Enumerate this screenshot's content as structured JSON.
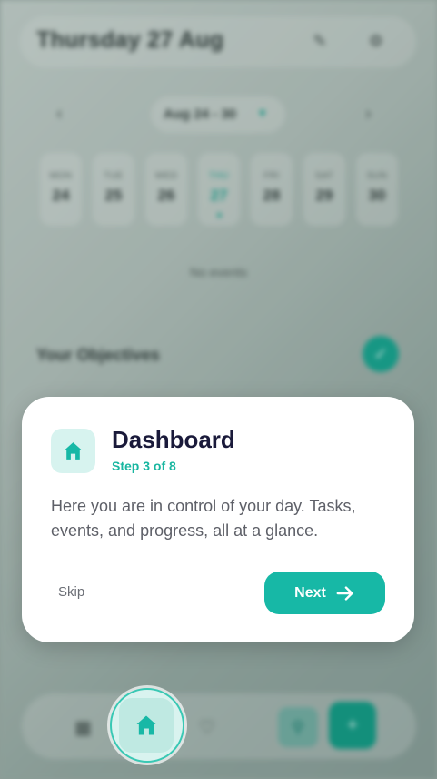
{
  "background": {
    "date_title": "Thursday 27 Aug",
    "week_range": "Aug 24 - 30",
    "week_days": [
      {
        "name": "MON",
        "date": "24"
      },
      {
        "name": "TUE",
        "date": "25"
      },
      {
        "name": "WED",
        "date": "26"
      },
      {
        "name": "THU",
        "date": "27"
      },
      {
        "name": "FRI",
        "date": "28"
      },
      {
        "name": "SAT",
        "date": "29"
      },
      {
        "name": "SUN",
        "date": "30"
      }
    ],
    "no_events": "No events",
    "objectives_title": "Your Objectives"
  },
  "dialog": {
    "icon": "home-icon",
    "title": "Dashboard",
    "step": "Step 3 of 8",
    "body": "Here you are in control of your day. Tasks, events, and progress, all at a glance.",
    "skip_label": "Skip",
    "next_label": "Next"
  },
  "colors": {
    "accent": "#17b8a6",
    "title": "#1a1a3a",
    "body_text": "#5e6068"
  }
}
